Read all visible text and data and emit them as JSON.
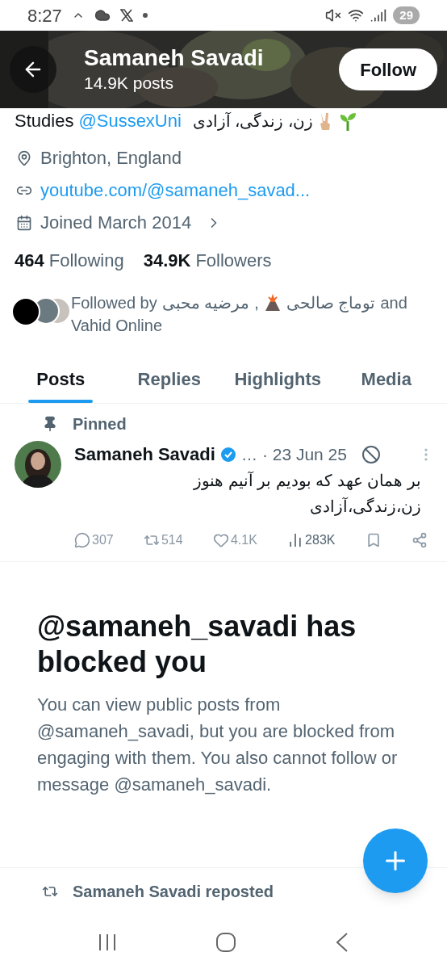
{
  "status_bar": {
    "time": "8:27",
    "battery": "29"
  },
  "header": {
    "name": "Samaneh Savadi",
    "posts": "14.9K posts",
    "follow_button": "Follow"
  },
  "bio": {
    "text": "Studies",
    "mention": "@SussexUni",
    "persian": "زن، زندگی، آزادی"
  },
  "details": [
    {
      "kind": "location",
      "text": "Brighton, England"
    },
    {
      "kind": "link",
      "text": "youtube.com/@samaneh_savad..."
    },
    {
      "kind": "joined",
      "text": "Joined March 2014"
    }
  ],
  "stats": [
    {
      "count": "464",
      "label": "Following"
    },
    {
      "count": "34.9K",
      "label": "Followers"
    }
  ],
  "followed_by": {
    "prefix": "Followed by",
    "names": [
      "توماج صالحی",
      "مرضیه محبی"
    ],
    "separator": ",",
    "suffix": "and",
    "last": "Vahid Online"
  },
  "tabs": [
    {
      "label": "Posts",
      "selected": true
    },
    {
      "label": "Replies",
      "selected": false
    },
    {
      "label": "Highlights",
      "selected": false
    },
    {
      "label": "Media",
      "selected": false
    }
  ],
  "pinned_post": {
    "pinned_label": "Pinned",
    "name": "Samaneh Savadi",
    "ellipsis": "…",
    "date": "· 23 Jun 25",
    "lines": [
      "بر همان عهد که بودیم بر آنیم هنوز",
      "زن،زندگی،آزادی"
    ],
    "actions": [
      {
        "kind": "reply",
        "count": "307",
        "disabled": true
      },
      {
        "kind": "repost",
        "count": "514",
        "disabled": true
      },
      {
        "kind": "like",
        "count": "4.1K",
        "disabled": true
      },
      {
        "kind": "views",
        "count": "283K",
        "disabled": false
      },
      {
        "kind": "bookmark",
        "disabled": true
      },
      {
        "kind": "share",
        "disabled": true
      }
    ]
  },
  "blocked": {
    "title": "@samaneh_savadi has blocked you",
    "body": "You can view public posts from @samaneh_savadi, but you are blocked from engaging with them. You also cannot follow or message @samaneh_savadi."
  },
  "repost_note": "Samaneh Savadi reposted"
}
